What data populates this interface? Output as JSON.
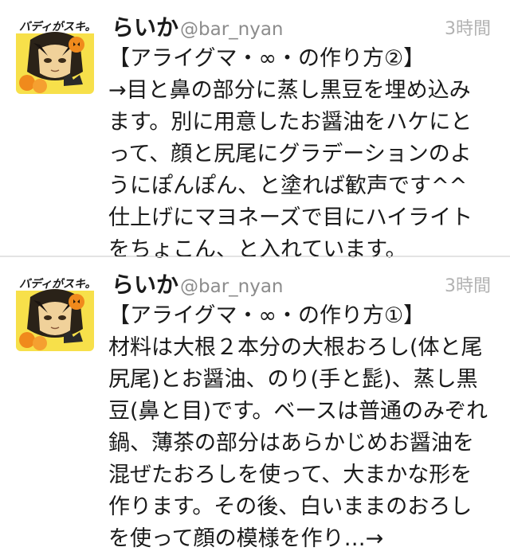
{
  "timeline": {
    "tweets": [
      {
        "display_name": "らいか",
        "username": "@bar_nyan",
        "timestamp": "3時間",
        "avatar_text": "バディがスキ。",
        "lines": [
          "【アライグマ・∞・の作り方②】",
          "→目と鼻の部分に蒸し黒豆を埋め込み",
          "ます。別に用意したお醤油をハケにと",
          "って、顔と尻尾にグラデーションのよ",
          "うにぽんぽん、と塗れば歓声です^^",
          "仕上げにマヨネーズで目にハイライト",
          "をちょこん、と入れています。"
        ]
      },
      {
        "display_name": "らいか",
        "username": "@bar_nyan",
        "timestamp": "3時間",
        "avatar_text": "バディがスキ。",
        "lines": [
          "【アライグマ・∞・の作り方①】",
          "材料は大根２本分の大根おろし(体と尾",
          "尻尾)とお醤油、のり(手と髭)、蒸し黒",
          "豆(鼻と目)です。ベースは普通のみぞれ",
          "鍋、薄茶の部分はあらかじめお醤油を",
          "混ぜたおろしを使って、大まかな形を",
          "作ります。その後、白いままのおろし",
          "を使って顔の模様を作り…→"
        ]
      }
    ]
  },
  "colors": {
    "name": "#1a1a1a",
    "username": "#8c8c8c",
    "timestamp": "#b2b2b2",
    "divider": "#e1e1e1",
    "pumpkin": "#f08a1c",
    "avatar_bg": "#fbe24a"
  }
}
